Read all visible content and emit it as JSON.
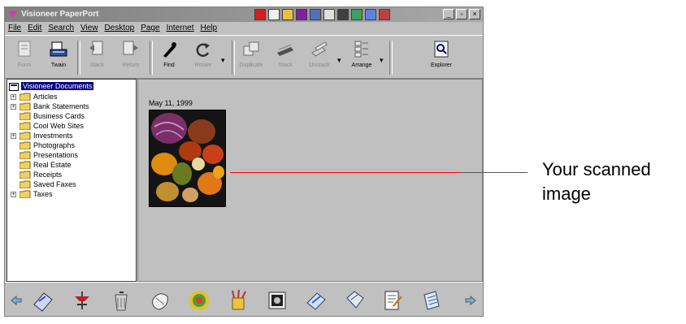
{
  "window": {
    "title": "Visioneer PaperPort",
    "controls": [
      "_",
      "▫",
      "×"
    ]
  },
  "menu": [
    "File",
    "Edit",
    "Search",
    "View",
    "Desktop",
    "Page",
    "Internet",
    "Help"
  ],
  "toolbar": [
    {
      "label": "Form",
      "icon": "form-icon",
      "enabled": false
    },
    {
      "label": "Twain",
      "icon": "scanner-icon",
      "enabled": true
    },
    {
      "label": "Stack",
      "icon": "stack-icon",
      "enabled": false
    },
    {
      "label": "Return",
      "icon": "return-icon",
      "enabled": false
    },
    {
      "label": "Find",
      "icon": "find-icon",
      "enabled": true
    },
    {
      "label": "Rotate",
      "icon": "rotate-icon",
      "enabled": false
    },
    {
      "label": "Duplicate",
      "icon": "duplicate-icon",
      "enabled": false
    },
    {
      "label": "Stack",
      "icon": "stack-pages-icon",
      "enabled": false
    },
    {
      "label": "Unstack",
      "icon": "unstack-icon",
      "enabled": false
    },
    {
      "label": "Arrange",
      "icon": "arrange-icon",
      "enabled": true
    },
    {
      "label": "Explorer",
      "icon": "explorer-icon",
      "enabled": true
    }
  ],
  "tree": {
    "root": "Visioneer Documents",
    "items": [
      {
        "label": "Articles",
        "expandable": true
      },
      {
        "label": "Bank Statements",
        "expandable": true
      },
      {
        "label": "Business Cards",
        "expandable": false
      },
      {
        "label": "Cool Web Sites",
        "expandable": false
      },
      {
        "label": "Investments",
        "expandable": true
      },
      {
        "label": "Photographs",
        "expandable": false
      },
      {
        "label": "Presentations",
        "expandable": false
      },
      {
        "label": "Real Estate",
        "expandable": false
      },
      {
        "label": "Receipts",
        "expandable": false
      },
      {
        "label": "Saved Faxes",
        "expandable": false
      },
      {
        "label": "Taxes",
        "expandable": true
      }
    ]
  },
  "viewer": {
    "thumbnail_date": "May 11, 1999"
  },
  "bottom_bar": {
    "icons": [
      "fax-icon",
      "scan-icon",
      "recycle-bin-icon",
      "wrap-icon",
      "pattern-icon",
      "paint-icon",
      "photo-editor-icon",
      "email-icon",
      "note-icon",
      "document-icon",
      "text-editor-icon"
    ]
  },
  "callout": {
    "text_line1": "Your scanned",
    "text_line2": "image",
    "line_color": "#ff0000"
  }
}
